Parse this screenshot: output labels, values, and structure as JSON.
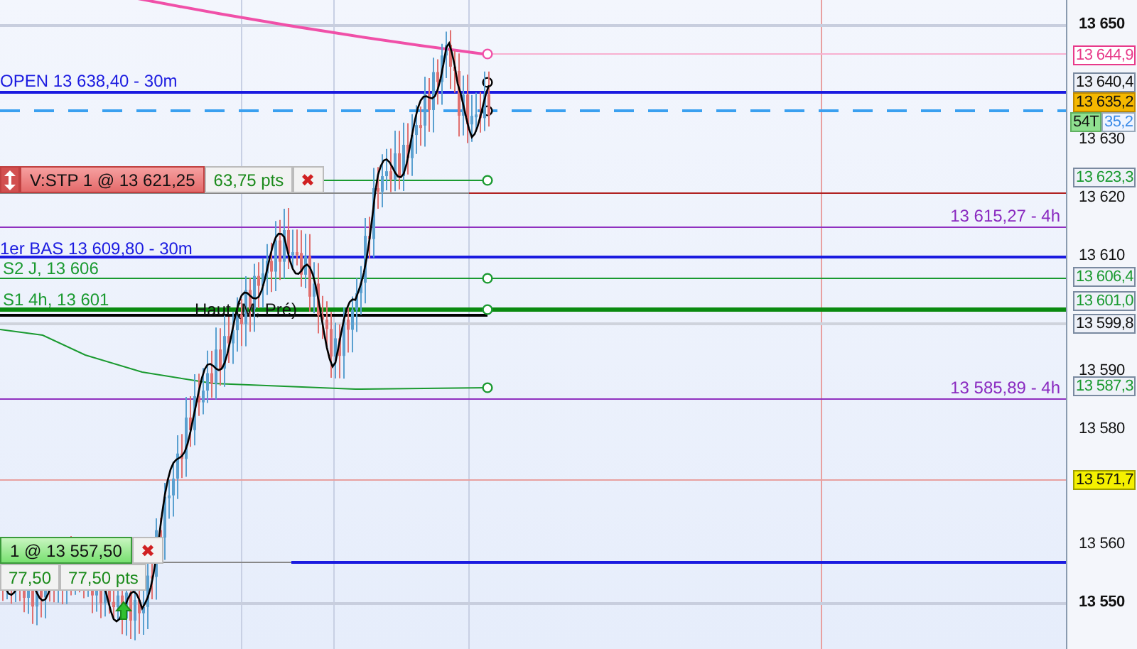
{
  "chart": {
    "labels": [
      {
        "text": "OPEN 13 638,40 - 30m",
        "kind": "blue"
      },
      {
        "text": "1er BAS 13 609,80 - 30m",
        "kind": "blue"
      },
      {
        "text": "S2 J, 13 606",
        "kind": "green"
      },
      {
        "text": "S1 4h, 13 601",
        "kind": "green"
      },
      {
        "text": "Haut (M, Pré)",
        "kind": "black"
      },
      {
        "text": "13 615,27 - 4h",
        "kind": "purple"
      },
      {
        "text": "13 585,89 - 4h",
        "kind": "purple"
      }
    ],
    "orders": [
      {
        "kind": "stop",
        "title": "V:STP  1 @ 13 621,25",
        "values": [
          "63,75 pts"
        ],
        "close": "✖"
      },
      {
        "kind": "fill",
        "title": "1 @ 13 557,50",
        "values": [
          "77,50",
          "77,50 pts"
        ],
        "close": "✖"
      }
    ]
  },
  "axis": {
    "ticks": [
      {
        "label": "13 650",
        "bold": true
      },
      {
        "label": "13 630",
        "bold": false
      },
      {
        "label": "13 620",
        "bold": false
      },
      {
        "label": "13 610",
        "bold": false
      },
      {
        "label": "13 590",
        "bold": false
      },
      {
        "label": "13 580",
        "bold": false
      },
      {
        "label": "13 560",
        "bold": false
      },
      {
        "label": "13 550",
        "bold": true
      }
    ],
    "tags": [
      {
        "label": "13 644,9",
        "kind": "pink"
      },
      {
        "label": "13 640,4",
        "kind": "plain"
      },
      {
        "label": "13 635,2",
        "kind": "orange"
      },
      {
        "label": "54T",
        "kind": "count"
      },
      {
        "label": "35,2",
        "kind": "blue"
      },
      {
        "label": "13 623,3",
        "kind": "green"
      },
      {
        "label": "13 606,4",
        "kind": "green"
      },
      {
        "label": "13 601,0",
        "kind": "green"
      },
      {
        "label": "13 599,8",
        "kind": "plain"
      },
      {
        "label": "13 587,3",
        "kind": "green"
      },
      {
        "label": "13 571,7",
        "kind": "yellow"
      }
    ]
  }
}
